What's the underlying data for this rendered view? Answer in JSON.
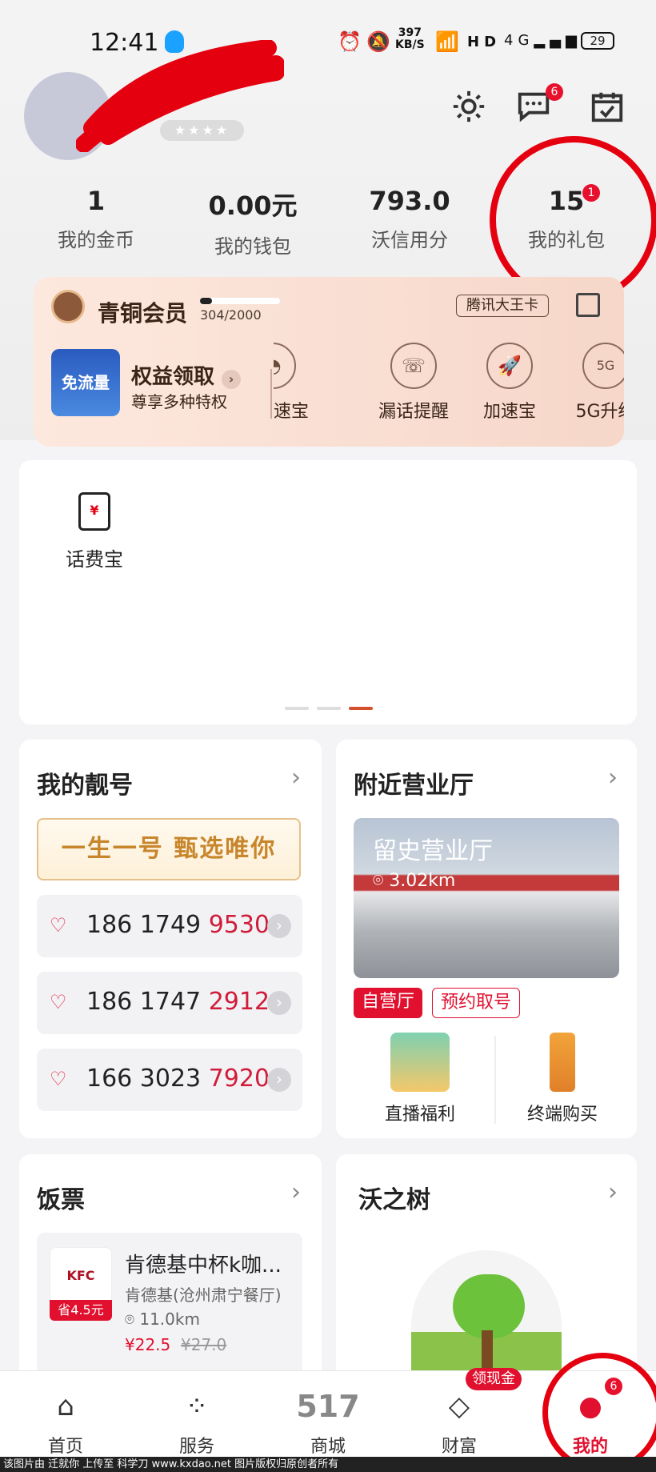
{
  "status_bar": {
    "time": "12:41",
    "speed_value": "397",
    "speed_unit": "KB/S",
    "battery": "29",
    "icons": [
      "alarm-icon",
      "mute-icon",
      "wifi-icon",
      "hd-icon",
      "signal-4g-icon",
      "signal-4g-icon"
    ]
  },
  "header": {
    "messages_badge": "6",
    "stats": [
      {
        "value": "1",
        "label": "我的金币"
      },
      {
        "value": "0.00元",
        "label": "我的钱包"
      },
      {
        "value": "793.0",
        "label": "沃信用分"
      },
      {
        "value": "15",
        "label": "我的礼包",
        "badge": "1"
      }
    ]
  },
  "member": {
    "level": "青铜会员",
    "progress_text": "304/2000",
    "progress": 0.152,
    "card_tag": "腾讯大王卡",
    "perk_image_text": "免流量",
    "perk_title": "权益领取",
    "perk_sub": "尊享多种特权",
    "items": [
      "速宝",
      "漏话提醒",
      "加速宝",
      "5G升级"
    ],
    "icon_glyphs": [
      "◔",
      "☏",
      "🚀",
      "5G"
    ]
  },
  "top_panel": {
    "item_label": "话费宝",
    "item_glyph": "¥",
    "dots": 3,
    "active_dot": 2
  },
  "numbers": {
    "title": "我的靓号",
    "banner": "一生一号 甄选唯你",
    "list": [
      {
        "prefix": "186 1749 ",
        "suffix": "9530"
      },
      {
        "prefix": "186 1747 ",
        "suffix": "2912"
      },
      {
        "prefix": "166 3023 ",
        "suffix": "7920"
      }
    ]
  },
  "nearby": {
    "title": "附近营业厅",
    "store_name": "留史营业厅",
    "distance": "3.02km",
    "chips": [
      "自营厅",
      "预约取号"
    ],
    "services": [
      {
        "label": "直播福利"
      },
      {
        "label": "终端购买"
      }
    ]
  },
  "meal": {
    "title": "饭票",
    "coupon_name": "肯德基中杯k咖...",
    "shop": "肯德基(沧州肃宁餐厅)",
    "distance": "11.0km",
    "price": "¥22.5",
    "old_price": "¥27.0",
    "save": "省4.5元",
    "logo": "KFC"
  },
  "tree": {
    "title": "沃之树"
  },
  "tabbar": {
    "tabs": [
      {
        "label": "首页",
        "icon": "⌂"
      },
      {
        "label": "服务",
        "icon": "⁘"
      },
      {
        "label": "商城",
        "icon": "517"
      },
      {
        "label": "财富",
        "icon": "◇"
      },
      {
        "label": "我的",
        "icon": "●"
      }
    ],
    "cash_label": "领现金",
    "mine_badge": "6"
  },
  "watermark": "该图片由 迁就你 上传至 科学刀 www.kxdao.net 图片版权归原创者所有"
}
